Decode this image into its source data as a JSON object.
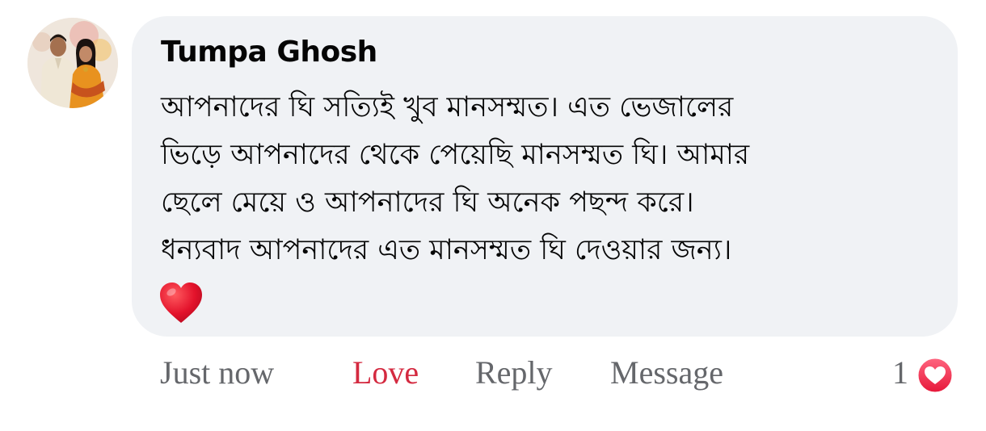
{
  "comment": {
    "author": "Tumpa Ghosh",
    "text_lines": [
      "আপনাদের ঘি সত্যিই খুব মানসম্মত। এত ভেজালের",
      "ভিড়ে আপনাদের থেকে পেয়েছি মানসম্মত ঘি। আমার",
      "ছেলে মেয়ে ও আপনাদের ঘি অনেক পছন্দ করে।",
      "ধন্যবাদ আপনাদের এত মানসম্মত ঘি দেওয়ার জন্য।"
    ],
    "emoji": "heart-emoji"
  },
  "actions": {
    "timestamp": "Just now",
    "love_label": "Love",
    "reply_label": "Reply",
    "message_label": "Message"
  },
  "reactions": {
    "count": "1",
    "icon": "love-reaction-icon"
  },
  "colors": {
    "bubble": "#f0f2f5",
    "love_active": "#d42a40",
    "muted_text": "#65676b",
    "reaction_red": "#f33e58"
  }
}
